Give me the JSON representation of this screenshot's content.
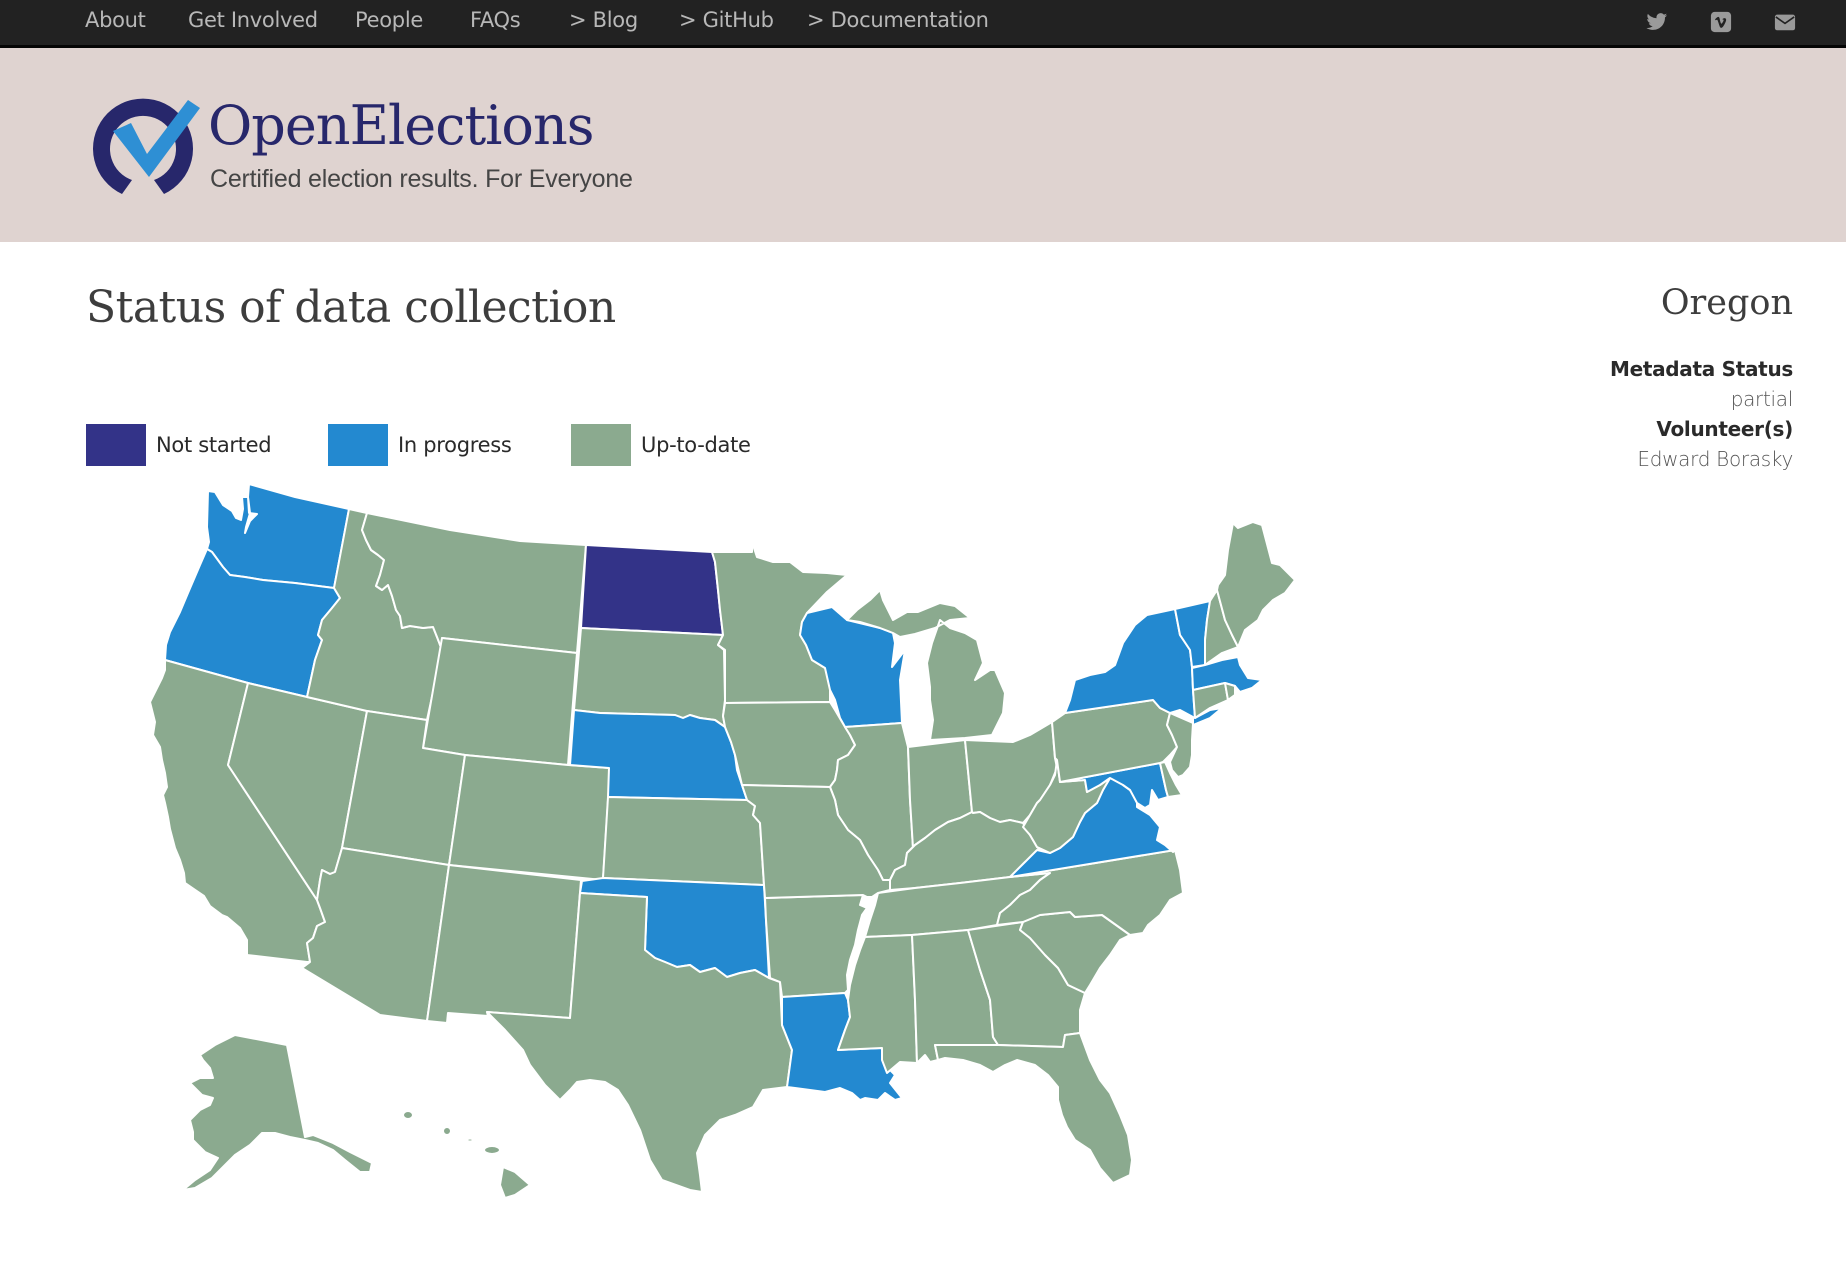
{
  "nav": {
    "links": [
      {
        "label": "About"
      },
      {
        "label": "Get Involved"
      },
      {
        "label": "People"
      },
      {
        "label": "FAQs"
      },
      {
        "label": "> Blog"
      },
      {
        "label": "> GitHub"
      },
      {
        "label": "> Documentation"
      }
    ],
    "social": [
      {
        "icon": "twitter-icon"
      },
      {
        "icon": "vimeo-icon"
      },
      {
        "icon": "envelope-icon"
      }
    ]
  },
  "brand": {
    "name": "OpenElections",
    "tagline": "Certified election results. For Everyone"
  },
  "page": {
    "title": "Status of data collection"
  },
  "legend": [
    {
      "status": "not_started",
      "label": "Not started",
      "color": "#333388"
    },
    {
      "status": "in_progress",
      "label": "In progress",
      "color": "#2389d0"
    },
    {
      "status": "up_to_date",
      "label": "Up-to-date",
      "color": "#8baa8f"
    }
  ],
  "detail": {
    "state": "Oregon",
    "metadata_status_label": "Metadata Status",
    "metadata_status_value": "partial",
    "volunteers_label": "Volunteer(s)",
    "volunteers_value": "Edward Borasky"
  },
  "states": {
    "WA": {
      "name": "Washington",
      "status": "in_progress"
    },
    "OR": {
      "name": "Oregon",
      "status": "in_progress"
    },
    "CA": {
      "name": "California",
      "status": "up_to_date"
    },
    "NV": {
      "name": "Nevada",
      "status": "up_to_date"
    },
    "ID": {
      "name": "Idaho",
      "status": "up_to_date"
    },
    "MT": {
      "name": "Montana",
      "status": "up_to_date"
    },
    "WY": {
      "name": "Wyoming",
      "status": "up_to_date"
    },
    "UT": {
      "name": "Utah",
      "status": "up_to_date"
    },
    "AZ": {
      "name": "Arizona",
      "status": "up_to_date"
    },
    "CO": {
      "name": "Colorado",
      "status": "up_to_date"
    },
    "NM": {
      "name": "New Mexico",
      "status": "up_to_date"
    },
    "ND": {
      "name": "North Dakota",
      "status": "not_started"
    },
    "SD": {
      "name": "South Dakota",
      "status": "up_to_date"
    },
    "NE": {
      "name": "Nebraska",
      "status": "in_progress"
    },
    "KS": {
      "name": "Kansas",
      "status": "up_to_date"
    },
    "OK": {
      "name": "Oklahoma",
      "status": "in_progress"
    },
    "TX": {
      "name": "Texas",
      "status": "up_to_date"
    },
    "MN": {
      "name": "Minnesota",
      "status": "up_to_date"
    },
    "IA": {
      "name": "Iowa",
      "status": "up_to_date"
    },
    "MO": {
      "name": "Missouri",
      "status": "up_to_date"
    },
    "AR": {
      "name": "Arkansas",
      "status": "up_to_date"
    },
    "LA": {
      "name": "Louisiana",
      "status": "in_progress"
    },
    "WI": {
      "name": "Wisconsin",
      "status": "in_progress"
    },
    "IL": {
      "name": "Illinois",
      "status": "up_to_date"
    },
    "MI": {
      "name": "Michigan",
      "status": "up_to_date"
    },
    "IN": {
      "name": "Indiana",
      "status": "up_to_date"
    },
    "OH": {
      "name": "Ohio",
      "status": "up_to_date"
    },
    "KY": {
      "name": "Kentucky",
      "status": "up_to_date"
    },
    "TN": {
      "name": "Tennessee",
      "status": "up_to_date"
    },
    "MS": {
      "name": "Mississippi",
      "status": "up_to_date"
    },
    "AL": {
      "name": "Alabama",
      "status": "up_to_date"
    },
    "GA": {
      "name": "Georgia",
      "status": "up_to_date"
    },
    "FL": {
      "name": "Florida",
      "status": "up_to_date"
    },
    "SC": {
      "name": "South Carolina",
      "status": "up_to_date"
    },
    "NC": {
      "name": "North Carolina",
      "status": "up_to_date"
    },
    "VA": {
      "name": "Virginia",
      "status": "in_progress"
    },
    "WV": {
      "name": "West Virginia",
      "status": "up_to_date"
    },
    "MD": {
      "name": "Maryland",
      "status": "in_progress"
    },
    "DE": {
      "name": "Delaware",
      "status": "up_to_date"
    },
    "PA": {
      "name": "Pennsylvania",
      "status": "up_to_date"
    },
    "NJ": {
      "name": "New Jersey",
      "status": "up_to_date"
    },
    "NY": {
      "name": "New York",
      "status": "in_progress"
    },
    "CT": {
      "name": "Connecticut",
      "status": "up_to_date"
    },
    "RI": {
      "name": "Rhode Island",
      "status": "up_to_date"
    },
    "MA": {
      "name": "Massachusetts",
      "status": "in_progress"
    },
    "VT": {
      "name": "Vermont",
      "status": "in_progress"
    },
    "NH": {
      "name": "New Hampshire",
      "status": "up_to_date"
    },
    "ME": {
      "name": "Maine",
      "status": "up_to_date"
    },
    "AK": {
      "name": "Alaska",
      "status": "up_to_date"
    },
    "HI": {
      "name": "Hawaii",
      "status": "up_to_date"
    }
  }
}
